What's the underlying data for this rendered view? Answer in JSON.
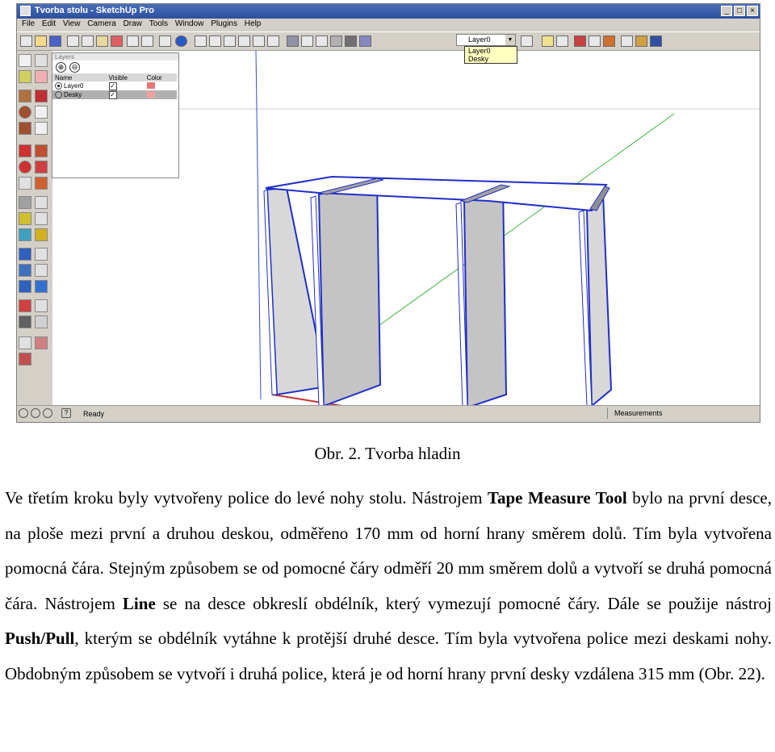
{
  "window": {
    "title": "Tvorba stolu - SketchUp Pro",
    "buttons": [
      "_",
      "□",
      "×"
    ]
  },
  "menu": [
    "File",
    "Edit",
    "View",
    "Camera",
    "Draw",
    "Tools",
    "Window",
    "Plugins",
    "Help"
  ],
  "layer_select": {
    "value": "Layer0",
    "options": [
      "Layer0",
      "Desky"
    ]
  },
  "layers_panel": {
    "title": "Layers",
    "add_symbol": "⊕",
    "remove_symbol": "⊖",
    "columns": [
      "Name",
      "Visible",
      "Color"
    ],
    "rows": [
      {
        "name": "Layer0",
        "visible": "✓",
        "color": "#e87878",
        "active": true
      },
      {
        "name": "Desky",
        "visible": "✓",
        "color": "#f4a0a0",
        "active": false
      }
    ]
  },
  "status": {
    "ready": "Ready",
    "measurements": "Measurements"
  },
  "colors": {
    "edge_blue": "#1f2fc8",
    "axis_green": "#3cb43c",
    "axis_red": "#c83232",
    "face_gray": "#c8c8c8"
  },
  "caption": "Obr. 2. Tvorba hladin",
  "paragraph": {
    "t1": "Ve třetím kroku byly vytvořeny police do levé nohy stolu. Nástrojem ",
    "b1": "Tape Measure Tool",
    "t2": " bylo na první desce, na ploše mezi první a druhou deskou, odměřeno 170 mm od horní hrany směrem dolů. Tím byla vytvořena pomocná čára. Stejným způsobem se od pomocné čáry odměří 20 mm směrem dolů a vytvoří se druhá pomocná čára. Nástrojem ",
    "b2": "Line",
    "t3": " se na desce obkreslí obdélník, který vymezují pomocné čáry. Dále se použije nástroj ",
    "b3": "Push/Pull",
    "t4": ", kterým se obdélník vytáhne k protější druhé desce. Tím byla vytvořena police mezi deskami nohy. Obdobným způsobem se vytvoří i druhá police, která je od horní hrany první desky vzdálena 315 mm (Obr. 22)."
  }
}
